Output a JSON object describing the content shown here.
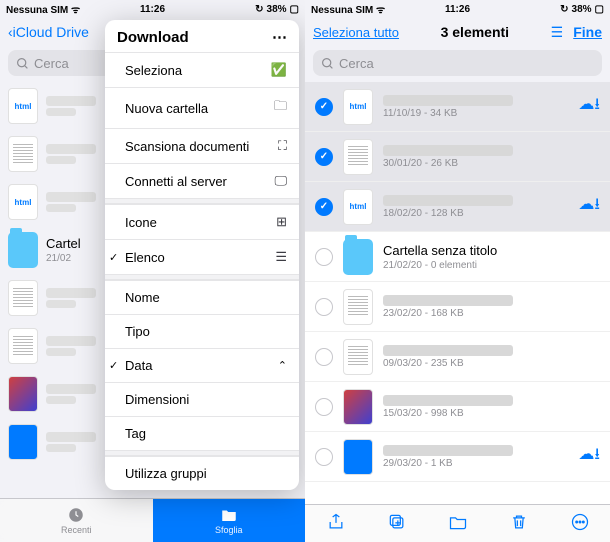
{
  "status": {
    "carrier": "Nessuna SIM",
    "time": "11:26",
    "battery": "38%"
  },
  "left": {
    "back": "iCloud Drive",
    "title": "Download",
    "search": "Cerca",
    "menu": {
      "select": "Seleziona",
      "new_folder": "Nuova cartella",
      "scan": "Scansiona documenti",
      "connect": "Connetti al server",
      "icons": "Icone",
      "list": "Elenco",
      "name": "Nome",
      "type": "Tipo",
      "date": "Data",
      "size": "Dimensioni",
      "tag": "Tag",
      "groups": "Utilizza gruppi"
    },
    "rows": {
      "folder_name": "Cartel",
      "folder_sub": "21/02"
    },
    "tabs": {
      "recent": "Recenti",
      "browse": "Sfoglia"
    }
  },
  "right": {
    "select_all": "Seleziona tutto",
    "title": "3 elementi",
    "done": "Fine",
    "search": "Cerca",
    "rows": [
      {
        "sub": "11/10/19 - 34 KB",
        "sel": true,
        "cloud": true,
        "thumb": "html"
      },
      {
        "sub": "30/01/20 - 26 KB",
        "sel": true,
        "cloud": false,
        "thumb": "doc"
      },
      {
        "sub": "18/02/20 - 128 KB",
        "sel": true,
        "cloud": true,
        "thumb": "html"
      },
      {
        "name": "Cartella senza titolo",
        "sub": "21/02/20 - 0 elementi",
        "sel": false,
        "cloud": false,
        "thumb": "folder"
      },
      {
        "sub": "23/02/20 - 168 KB",
        "sel": false,
        "cloud": false,
        "thumb": "doc"
      },
      {
        "sub": "09/03/20 - 235 KB",
        "sel": false,
        "cloud": false,
        "thumb": "doclines"
      },
      {
        "sub": "15/03/20 - 998 KB",
        "sel": false,
        "cloud": false,
        "thumb": "photo"
      },
      {
        "sub": "29/03/20 - 1 KB",
        "sel": false,
        "cloud": true,
        "thumb": "sheet"
      }
    ]
  }
}
